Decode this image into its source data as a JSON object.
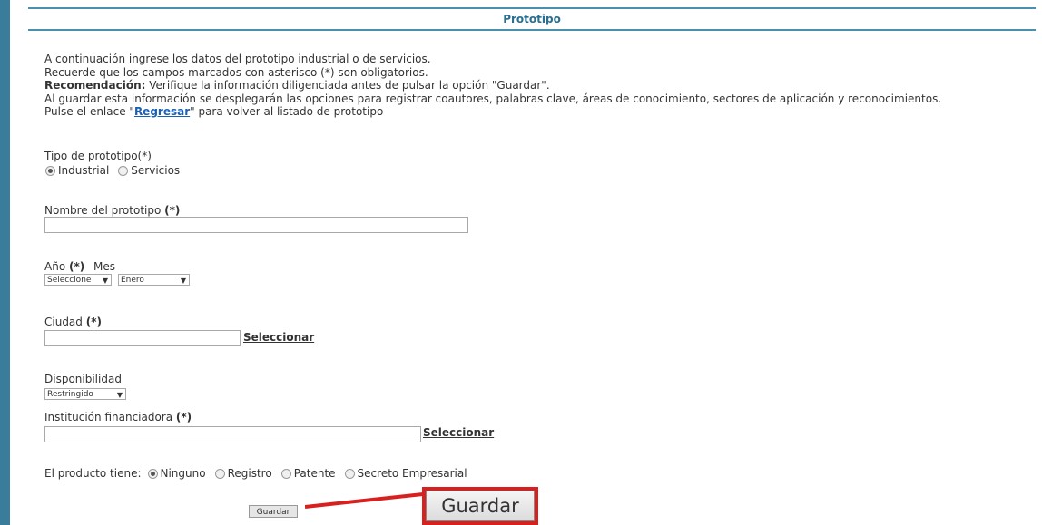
{
  "header": {
    "title": "Prototipo"
  },
  "intro": {
    "line1": "A continuación ingrese los datos del prototipo industrial o de servicios.",
    "line2": "Recuerde que los campos marcados con asterisco (*) son obligatorios.",
    "line3_bold": "Recomendación:",
    "line3_rest": " Verifique la información diligenciada antes de pulsar la opción \"Guardar\".",
    "line4": "Al guardar esta información se desplegarán las opciones para registrar coautores, palabras clave, áreas de conocimiento, sectores de aplicación y reconocimientos.",
    "line5_pre": "Pulse el enlace \"",
    "line5_link": "Regresar",
    "line5_post": "\" para volver al listado de prototipo"
  },
  "tipo": {
    "label": "Tipo de prototipo(*)",
    "options": [
      {
        "label": "Industrial",
        "selected": true
      },
      {
        "label": "Servicios",
        "selected": false
      }
    ]
  },
  "nombre": {
    "label": "Nombre del prototipo ",
    "req": "(*)",
    "value": ""
  },
  "anio": {
    "label": "Año ",
    "req": "(*)",
    "selected": "Seleccione"
  },
  "mes": {
    "label": "Mes",
    "selected": "Enero"
  },
  "ciudad": {
    "label": "Ciudad ",
    "req": "(*)",
    "value": "",
    "link": "Seleccionar"
  },
  "disponibilidad": {
    "label": "Disponibilidad",
    "selected": "Restringido"
  },
  "institucion": {
    "label": "Institución financiadora ",
    "req": "(*)",
    "value": "",
    "link": "Seleccionar"
  },
  "producto": {
    "label": "El producto tiene:",
    "options": [
      {
        "label": "Ninguno",
        "selected": true
      },
      {
        "label": "Registro",
        "selected": false
      },
      {
        "label": "Patente",
        "selected": false
      },
      {
        "label": "Secreto Empresarial",
        "selected": false
      }
    ]
  },
  "buttons": {
    "guardar": "Guardar",
    "guardar_callout": "Guardar"
  },
  "colors": {
    "accent": "#3a7d9a",
    "link": "#1a5fb4",
    "callout": "#d8201e"
  }
}
